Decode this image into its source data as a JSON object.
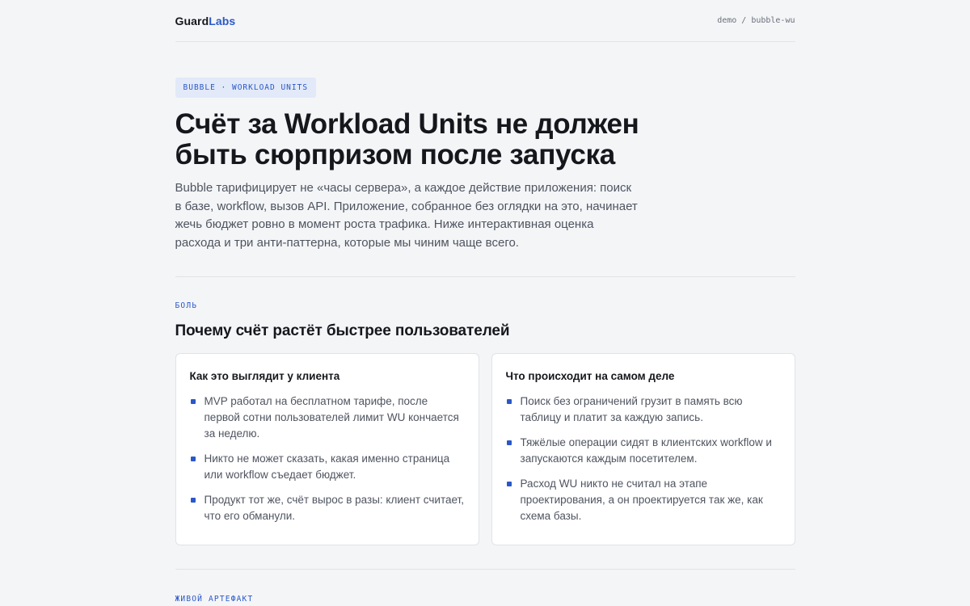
{
  "header": {
    "logo_part1": "Guard",
    "logo_part2": "Labs",
    "breadcrumb": [
      "demo",
      "/",
      "bubble-wu"
    ]
  },
  "hero": {
    "tag": "BUBBLE · WORKLOAD UNITS",
    "title": "Счёт за Workload Units не должен быть сюрпризом после запуска",
    "lead": "Bubble тарифицирует не «часы сервера», а каждое действие приложения: поиск в базе, workflow, вызов API. Приложение, собранное без оглядки на это, начинает жечь бюджет ровно в момент роста трафика. Ниже интерактивная оценка расхода и три анти-паттерна, которые мы чиним чаще всего."
  },
  "pain": {
    "label": "БОЛЬ",
    "title": "Почему счёт растёт быстрее пользователей",
    "cards": [
      {
        "title": "Как это выглядит у клиента",
        "items": [
          "MVP работал на бесплатном тарифе, после первой сотни пользователей лимит WU кончается за неделю.",
          "Никто не может сказать, какая именно страница или workflow съедает бюджет.",
          "Продукт тот же, счёт вырос в разы: клиент считает, что его обманули."
        ]
      },
      {
        "title": "Что происходит на самом деле",
        "items": [
          "Поиск без ограничений грузит в память всю таблицу и платит за каждую запись.",
          "Тяжёлые операции сидят в клиентских workflow и запускаются каждым посетителем.",
          "Расход WU никто не считал на этапе проектирования, а он проектируется так же, как схема базы."
        ]
      }
    ]
  },
  "artifact": {
    "label": "ЖИВОЙ АРТЕФАКТ"
  },
  "colors": {
    "accent": "#2a58c9",
    "background": "#f4f5f7",
    "card": "#ffffff",
    "text": "#15171c",
    "muted": "#4f5460"
  }
}
